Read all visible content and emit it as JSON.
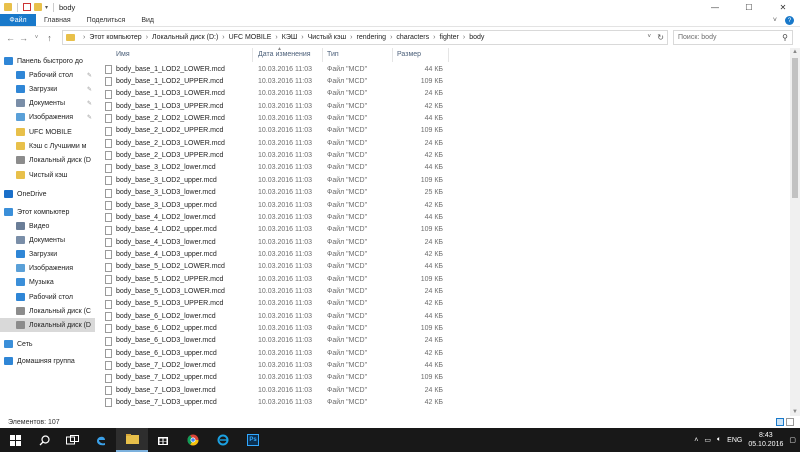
{
  "window": {
    "title": "body",
    "controls": {
      "minimize": "—",
      "maximize": "☐",
      "close": "✕"
    }
  },
  "ribbon": {
    "tabs": [
      "Файл",
      "Главная",
      "Поделиться",
      "Вид"
    ],
    "expand": "˅",
    "help": "?"
  },
  "address": {
    "breadcrumbs": [
      "Этот компьютер",
      "Локальный диск (D:)",
      "UFC MOBILE",
      "КЭШ",
      "Чистый кэш",
      "rendering",
      "characters",
      "fighter",
      "body"
    ],
    "search_placeholder": "Поиск: body"
  },
  "nav": {
    "items": [
      {
        "label": "Панель быстрого до",
        "icon": "star-icon",
        "color": "#2f86d6",
        "pinned": false
      },
      {
        "label": "Рабочий стол",
        "icon": "desktop-icon",
        "color": "#2f86d6",
        "pinned": true
      },
      {
        "label": "Загрузки",
        "icon": "download-icon",
        "color": "#2f86d6",
        "pinned": true
      },
      {
        "label": "Документы",
        "icon": "documents-icon",
        "color": "#7a8ea8",
        "pinned": true
      },
      {
        "label": "Изображения",
        "icon": "pictures-icon",
        "color": "#5aa0d8",
        "pinned": true
      },
      {
        "label": "UFC MOBILE",
        "icon": "folder-icon",
        "color": "#e8c04a",
        "pinned": false
      },
      {
        "label": "Кэш с Лучшими м",
        "icon": "folder-icon",
        "color": "#e8c04a",
        "pinned": false
      },
      {
        "label": "Локальный диск (D",
        "icon": "drive-icon",
        "color": "#8c8c8c",
        "pinned": false
      },
      {
        "label": "Чистый кэш",
        "icon": "folder-icon",
        "color": "#e8c04a",
        "pinned": false
      },
      {
        "label": "OneDrive",
        "icon": "onedrive-icon",
        "color": "#1a6fc9",
        "pinned": false
      },
      {
        "label": "Этот компьютер",
        "icon": "computer-icon",
        "color": "#3b8fd9",
        "pinned": false
      },
      {
        "label": "Видео",
        "icon": "video-icon",
        "color": "#6a7d97",
        "pinned": false
      },
      {
        "label": "Документы",
        "icon": "documents-icon",
        "color": "#7a8ea8",
        "pinned": false
      },
      {
        "label": "Загрузки",
        "icon": "download-icon",
        "color": "#2f86d6",
        "pinned": false
      },
      {
        "label": "Изображения",
        "icon": "pictures-icon",
        "color": "#5aa0d8",
        "pinned": false
      },
      {
        "label": "Музыка",
        "icon": "music-icon",
        "color": "#3b8fd9",
        "pinned": false
      },
      {
        "label": "Рабочий стол",
        "icon": "desktop-icon",
        "color": "#2f86d6",
        "pinned": false
      },
      {
        "label": "Локальный диск (C",
        "icon": "drive-icon",
        "color": "#8c8c8c",
        "pinned": false
      },
      {
        "label": "Локальный диск (D",
        "icon": "drive-icon",
        "color": "#8c8c8c",
        "pinned": false
      },
      {
        "label": "Сеть",
        "icon": "network-icon",
        "color": "#3b8fd9",
        "pinned": false
      },
      {
        "label": "Домашняя группа",
        "icon": "homegroup-icon",
        "color": "#2f86d6",
        "pinned": false
      }
    ]
  },
  "columns": {
    "name": "Имя",
    "date": "Дата изменения",
    "type": "Тип",
    "size": "Размер"
  },
  "files": [
    {
      "name": "body_base_1_LOD2_LOWER.mcd",
      "date": "10.03.2016 11:03",
      "type": "Файл \"MCD\"",
      "size": "44 КБ"
    },
    {
      "name": "body_base_1_LOD2_UPPER.mcd",
      "date": "10.03.2016 11:03",
      "type": "Файл \"MCD\"",
      "size": "109 КБ"
    },
    {
      "name": "body_base_1_LOD3_LOWER.mcd",
      "date": "10.03.2016 11:03",
      "type": "Файл \"MCD\"",
      "size": "24 КБ"
    },
    {
      "name": "body_base_1_LOD3_UPPER.mcd",
      "date": "10.03.2016 11:03",
      "type": "Файл \"MCD\"",
      "size": "42 КБ"
    },
    {
      "name": "body_base_2_LOD2_LOWER.mcd",
      "date": "10.03.2016 11:03",
      "type": "Файл \"MCD\"",
      "size": "44 КБ"
    },
    {
      "name": "body_base_2_LOD2_UPPER.mcd",
      "date": "10.03.2016 11:03",
      "type": "Файл \"MCD\"",
      "size": "109 КБ"
    },
    {
      "name": "body_base_2_LOD3_LOWER.mcd",
      "date": "10.03.2016 11:03",
      "type": "Файл \"MCD\"",
      "size": "24 КБ"
    },
    {
      "name": "body_base_2_LOD3_UPPER.mcd",
      "date": "10.03.2016 11:03",
      "type": "Файл \"MCD\"",
      "size": "42 КБ"
    },
    {
      "name": "body_base_3_LOD2_lower.mcd",
      "date": "10.03.2016 11:03",
      "type": "Файл \"MCD\"",
      "size": "44 КБ"
    },
    {
      "name": "body_base_3_LOD2_upper.mcd",
      "date": "10.03.2016 11:03",
      "type": "Файл \"MCD\"",
      "size": "109 КБ"
    },
    {
      "name": "body_base_3_LOD3_lower.mcd",
      "date": "10.03.2016 11:03",
      "type": "Файл \"MCD\"",
      "size": "25 КБ"
    },
    {
      "name": "body_base_3_LOD3_upper.mcd",
      "date": "10.03.2016 11:03",
      "type": "Файл \"MCD\"",
      "size": "42 КБ"
    },
    {
      "name": "body_base_4_LOD2_lower.mcd",
      "date": "10.03.2016 11:03",
      "type": "Файл \"MCD\"",
      "size": "44 КБ"
    },
    {
      "name": "body_base_4_LOD2_upper.mcd",
      "date": "10.03.2016 11:03",
      "type": "Файл \"MCD\"",
      "size": "109 КБ"
    },
    {
      "name": "body_base_4_LOD3_lower.mcd",
      "date": "10.03.2016 11:03",
      "type": "Файл \"MCD\"",
      "size": "24 КБ"
    },
    {
      "name": "body_base_4_LOD3_upper.mcd",
      "date": "10.03.2016 11:03",
      "type": "Файл \"MCD\"",
      "size": "42 КБ"
    },
    {
      "name": "body_base_5_LOD2_LOWER.mcd",
      "date": "10.03.2016 11:03",
      "type": "Файл \"MCD\"",
      "size": "44 КБ"
    },
    {
      "name": "body_base_5_LOD2_UPPER.mcd",
      "date": "10.03.2016 11:03",
      "type": "Файл \"MCD\"",
      "size": "109 КБ"
    },
    {
      "name": "body_base_5_LOD3_LOWER.mcd",
      "date": "10.03.2016 11:03",
      "type": "Файл \"MCD\"",
      "size": "24 КБ"
    },
    {
      "name": "body_base_5_LOD3_UPPER.mcd",
      "date": "10.03.2016 11:03",
      "type": "Файл \"MCD\"",
      "size": "42 КБ"
    },
    {
      "name": "body_base_6_LOD2_lower.mcd",
      "date": "10.03.2016 11:03",
      "type": "Файл \"MCD\"",
      "size": "44 КБ"
    },
    {
      "name": "body_base_6_LOD2_upper.mcd",
      "date": "10.03.2016 11:03",
      "type": "Файл \"MCD\"",
      "size": "109 КБ"
    },
    {
      "name": "body_base_6_LOD3_lower.mcd",
      "date": "10.03.2016 11:03",
      "type": "Файл \"MCD\"",
      "size": "24 КБ"
    },
    {
      "name": "body_base_6_LOD3_upper.mcd",
      "date": "10.03.2016 11:03",
      "type": "Файл \"MCD\"",
      "size": "42 КБ"
    },
    {
      "name": "body_base_7_LOD2_lower.mcd",
      "date": "10.03.2016 11:03",
      "type": "Файл \"MCD\"",
      "size": "44 КБ"
    },
    {
      "name": "body_base_7_LOD2_upper.mcd",
      "date": "10.03.2016 11:03",
      "type": "Файл \"MCD\"",
      "size": "109 КБ"
    },
    {
      "name": "body_base_7_LOD3_lower.mcd",
      "date": "10.03.2016 11:03",
      "type": "Файл \"MCD\"",
      "size": "24 КБ"
    },
    {
      "name": "body_base_7_LOD3_upper.mcd",
      "date": "10.03.2016 11:03",
      "type": "Файл \"MCD\"",
      "size": "42 КБ"
    }
  ],
  "status": {
    "items_count": "Элементов: 107"
  },
  "taskbar": {
    "apps": [
      {
        "name": "start-icon"
      },
      {
        "name": "search-icon"
      },
      {
        "name": "task-view-icon"
      },
      {
        "name": "edge-icon"
      },
      {
        "name": "file-explorer-icon"
      },
      {
        "name": "store-icon"
      },
      {
        "name": "chrome-icon"
      },
      {
        "name": "ie-icon"
      },
      {
        "name": "photoshop-icon"
      }
    ],
    "lang": "ENG",
    "time": "8:43",
    "date": "05.10.2016",
    "ps_label": "Ps"
  },
  "colors": {
    "accent": "#1979ca",
    "taskbar": "#181818",
    "folder": "#e8c04a"
  }
}
